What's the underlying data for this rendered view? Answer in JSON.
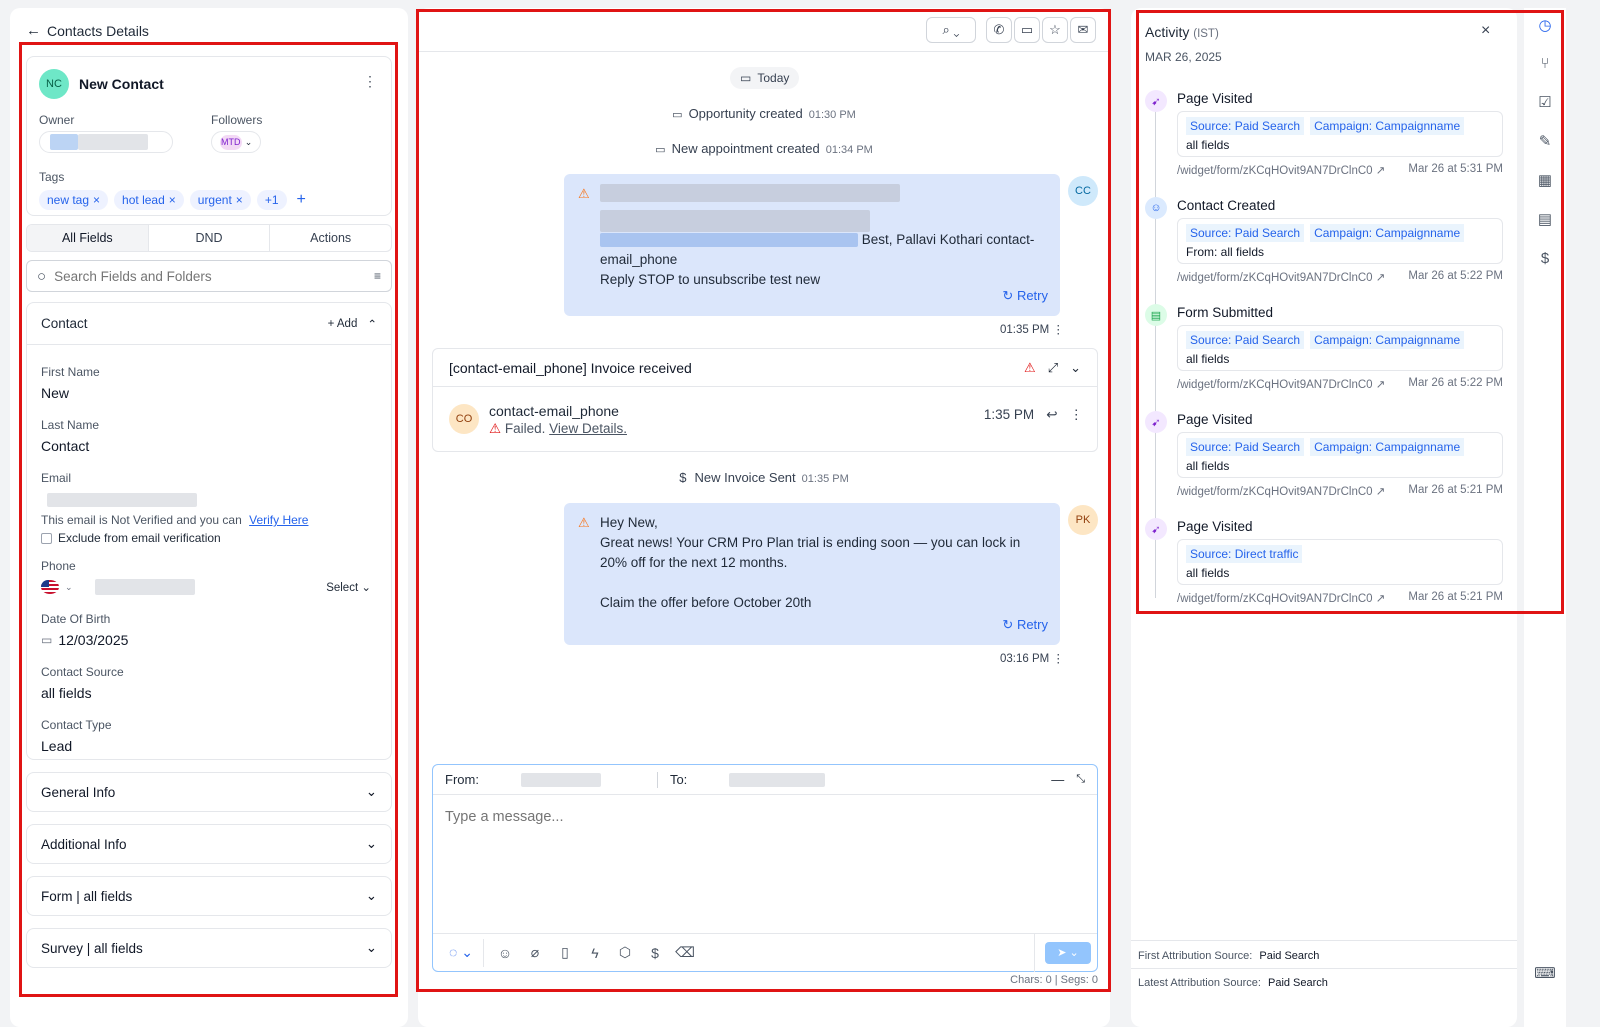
{
  "left": {
    "back_title": "Contacts Details",
    "contact": {
      "initials": "NC",
      "name": "New Contact"
    },
    "owner_label": "Owner",
    "followers_label": "Followers",
    "follower_badge": "MTD",
    "tags_label": "Tags",
    "tags": [
      "new tag",
      "hot lead",
      "urgent"
    ],
    "tags_more": "+1",
    "tabs": [
      "All Fields",
      "DND",
      "Actions"
    ],
    "search_placeholder": "Search Fields and Folders",
    "contact_section": {
      "title": "Contact",
      "add_label": "Add"
    },
    "fields": {
      "first_name_label": "First Name",
      "first_name": "New",
      "last_name_label": "Last Name",
      "last_name": "Contact",
      "email_label": "Email",
      "email_note": "This email is Not Verified and you can",
      "verify_link": "Verify Here",
      "exclude_label": "Exclude from email verification",
      "phone_label": "Phone",
      "phone_select": "Select",
      "dob_label": "Date Of Birth",
      "dob": "12/03/2025",
      "source_label": "Contact Source",
      "source": "all fields",
      "type_label": "Contact Type",
      "type": "Lead"
    },
    "sections": [
      "General Info",
      "Additional Info",
      "Form | all fields",
      "Survey | all fields"
    ]
  },
  "middle": {
    "today": "Today",
    "events": [
      {
        "text": "Opportunity created",
        "time": "01:30 PM"
      },
      {
        "text": "New appointment created",
        "time": "01:34 PM"
      }
    ],
    "msg1": {
      "avatar": "CC",
      "line_tail": "Best, Pallavi Kothari contact-",
      "line2": "email_phone",
      "line3": "Reply STOP to unsubscribe test new",
      "retry": "Retry",
      "time": "01:35 PM"
    },
    "invoice": {
      "subject": "[contact-email_phone] Invoice received",
      "avatar": "CO",
      "sender": "contact-email_phone",
      "failed": "Failed.",
      "view_details": "View Details.",
      "time": "1:35 PM"
    },
    "invoice_event": {
      "text": "New Invoice Sent",
      "time": "01:35 PM"
    },
    "msg2": {
      "avatar": "PK",
      "lines": [
        "Hey New,",
        "Great news! Your CRM Pro Plan trial is ending soon — you can lock in",
        "20% off for the next 12 months.",
        "",
        "Claim the offer before October 20th"
      ],
      "retry": "Retry",
      "time": "03:16 PM"
    },
    "composer": {
      "from_label": "From:",
      "to_label": "To:",
      "placeholder": "Type a message...",
      "counter": "Chars: 0 | Segs: 0"
    }
  },
  "right": {
    "title": "Activity",
    "tz": "(IST)",
    "date": "MAR 26, 2025",
    "items": [
      {
        "title": "Page Visited",
        "chips": [
          "Source: Paid Search",
          "Campaign: Campaignname"
        ],
        "sub": "all fields",
        "url": "/widget/form/zKCqHOvit9AN7DrClnC0",
        "time": "Mar 26 at 5:31 PM",
        "icon": "cursor-icon"
      },
      {
        "title": "Contact Created",
        "chips": [
          "Source: Paid Search",
          "Campaign: Campaignname"
        ],
        "sub": "From: all fields",
        "url": "/widget/form/zKCqHOvit9AN7DrClnC0",
        "time": "Mar 26 at 5:22 PM",
        "icon": "user-icon"
      },
      {
        "title": "Form Submitted",
        "chips": [
          "Source: Paid Search",
          "Campaign: Campaignname"
        ],
        "sub": "all fields",
        "url": "/widget/form/zKCqHOvit9AN7DrClnC0",
        "time": "Mar 26 at 5:22 PM",
        "icon": "form-icon"
      },
      {
        "title": "Page Visited",
        "chips": [
          "Source: Paid Search",
          "Campaign: Campaignname"
        ],
        "sub": "all fields",
        "url": "/widget/form/zKCqHOvit9AN7DrClnC0",
        "time": "Mar 26 at 5:21 PM",
        "icon": "cursor-icon"
      },
      {
        "title": "Page Visited",
        "chips": [
          "Source: Direct traffic"
        ],
        "sub": "all fields",
        "url": "/widget/form/zKCqHOvit9AN7DrClnC0",
        "time": "Mar 26 at 5:21 PM",
        "icon": "cursor-icon"
      }
    ],
    "first_attr_label": "First Attribution Source:",
    "first_attr": "Paid Search",
    "latest_attr_label": "Latest Attribution Source:",
    "latest_attr": "Paid Search"
  },
  "colors": {
    "accent": "#2563eb",
    "alert": "#e01414",
    "bubble": "#dbe6fb"
  }
}
